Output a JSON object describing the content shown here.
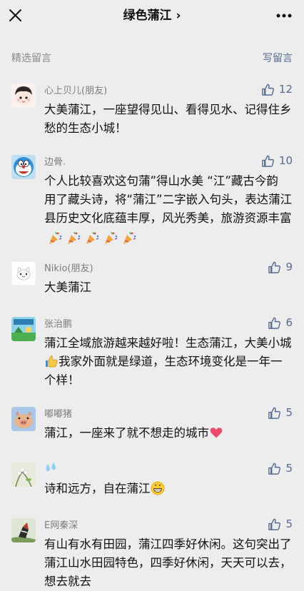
{
  "header": {
    "title": "绿色蒲江 ›"
  },
  "section": {
    "label": "精选留言",
    "write_label": "写留言"
  },
  "colors": {
    "background": "#ededed",
    "link": "#576b95",
    "text": "#111111",
    "muted": "#7d7d7d"
  },
  "comments": [
    {
      "nick": "心上贝儿(朋友)",
      "likes": "12",
      "text": "大美蒲江，一座望得见山、看得见水、记得住乡愁的生态小城！"
    },
    {
      "nick": "边骨.",
      "likes": "10",
      "text": "个人比较喜欢这句蒲”得山水美 “江”藏古今韵 用了藏头诗，将“蒲江”二字嵌入句头，表达蒲江县历史文化底蕴丰厚，风光秀美，旅游资源丰富",
      "emoji": "party-popper x5"
    },
    {
      "nick": "Nikio(朋友)",
      "likes": "9",
      "text": "大美蒲江"
    },
    {
      "nick": "张治鹏",
      "likes": "6",
      "text_a": "蒲江全域旅游越来越好啦！生态蒲江，大美小城",
      "text_b": "我家外面就是绿道，生态环境变化是一年一个样！",
      "emoji": "thumbs-up"
    },
    {
      "nick": "嘟嘟猪",
      "likes": "5",
      "text": "蒲江，一座来了就不想走的城市",
      "emoji": "heart"
    },
    {
      "nick": "",
      "likes": "5",
      "text": "诗和远方，自在蒲江",
      "emoji": "grinning-face"
    },
    {
      "nick": "E网秦深",
      "likes": "5",
      "text": "有山有水有田园，蒲江四季好休闲。这句突出了蒲江山水田园特色，四季好休闲，天天可以去，想去就去"
    }
  ]
}
